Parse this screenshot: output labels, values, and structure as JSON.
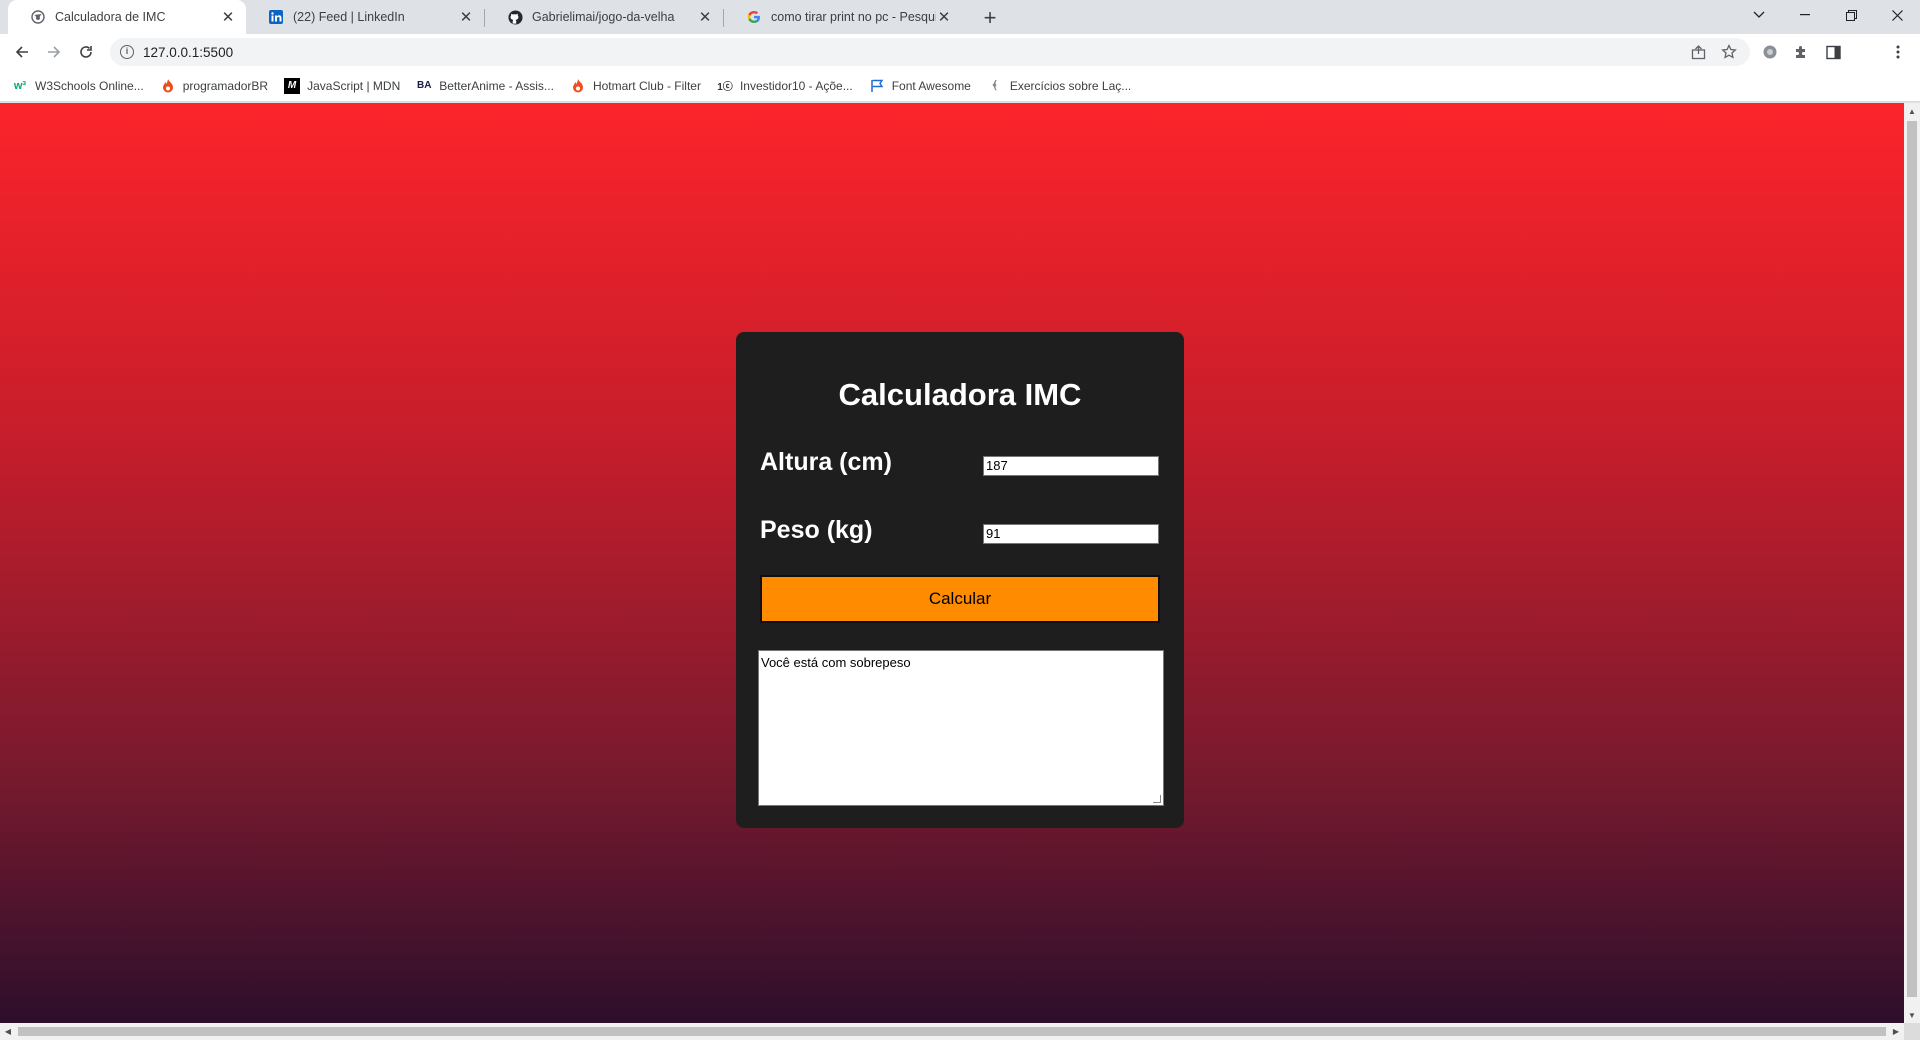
{
  "browser": {
    "tabs": [
      {
        "title": "Calculadora de IMC",
        "active": true,
        "icon": "globe-icon"
      },
      {
        "title": "(22) Feed | LinkedIn",
        "active": false,
        "icon": "linkedin-icon"
      },
      {
        "title": "Gabrielimai/jogo-da-velha",
        "active": false,
        "icon": "github-icon"
      },
      {
        "title": "como tirar print no pc - Pesquisa",
        "active": false,
        "icon": "google-icon"
      }
    ],
    "url": "127.0.0.1:5500",
    "bookmarks": [
      {
        "label": "W3Schools Online...",
        "icon": "w3schools-icon"
      },
      {
        "label": "programadorBR",
        "icon": "fire-icon"
      },
      {
        "label": "JavaScript | MDN",
        "icon": "mdn-icon"
      },
      {
        "label": "BetterAnime - Assis...",
        "icon": "betteranime-icon"
      },
      {
        "label": "Hotmart Club - Filter",
        "icon": "hotmart-icon"
      },
      {
        "label": "Investidor10 - Açõe...",
        "icon": "investidor10-icon"
      },
      {
        "label": "Font Awesome",
        "icon": "flag-icon"
      },
      {
        "label": "Exercícios sobre Laç...",
        "icon": "page-icon"
      }
    ]
  },
  "app": {
    "title": "Calculadora IMC",
    "height_label": "Altura (cm)",
    "height_value": "187",
    "weight_label": "Peso (kg)",
    "weight_value": "91",
    "button_label": "Calcular",
    "result_text": "Você está com sobrepeso"
  },
  "colors": {
    "gradient_top": "#fc242b",
    "gradient_bottom": "#2d0e2c",
    "card_bg": "#1e1e1e",
    "button_bg": "#ff8c00"
  }
}
